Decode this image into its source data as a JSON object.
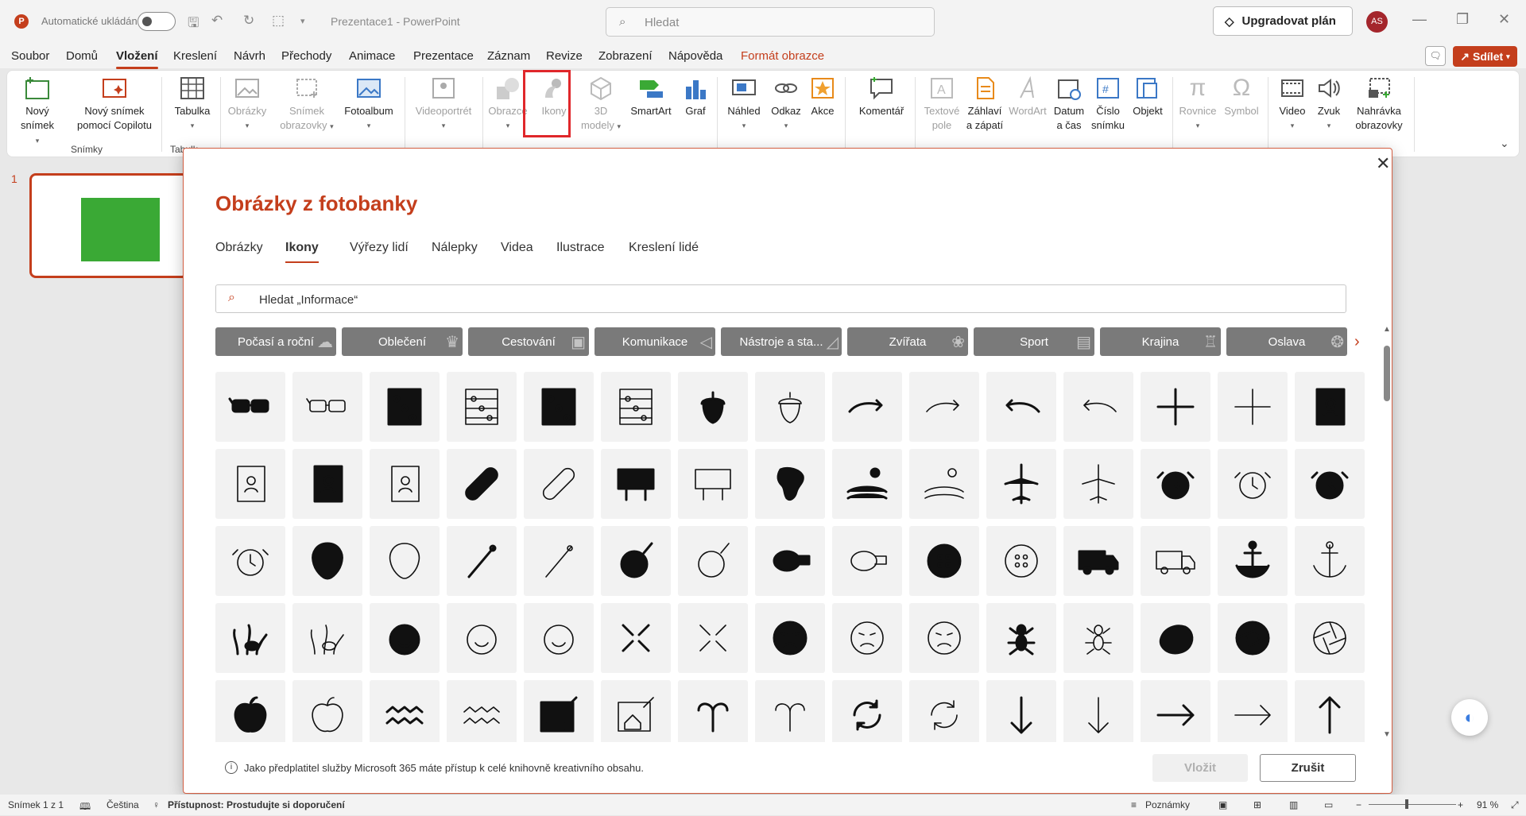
{
  "titlebar": {
    "autosave_label": "Automatické ukládání",
    "doc_title": "Prezentace1 - PowerPoint",
    "search_placeholder": "Hledat",
    "upgrade_label": "Upgradovat plán",
    "avatar_initials": "AS"
  },
  "menu": {
    "items": [
      "Soubor",
      "Domů",
      "Vložení",
      "Kreslení",
      "Návrh",
      "Přechody",
      "Animace",
      "Prezentace",
      "Záznam",
      "Revize",
      "Zobrazení",
      "Nápověda",
      "Formát obrazce"
    ],
    "active": "Vložení",
    "share_label": "Sdílet"
  },
  "ribbon": {
    "buttons": [
      {
        "label1": "Nový",
        "label2": "snímek",
        "icon": "new-slide-icon"
      },
      {
        "label1": "Nový snímek",
        "label2": "pomocí Copilotu",
        "icon": "copilot-slide-icon"
      },
      {
        "label1": "Tabulka",
        "label2": "",
        "icon": "table-icon"
      },
      {
        "label1": "Obrázky",
        "label2": "",
        "icon": "pictures-icon"
      },
      {
        "label1": "Snímek",
        "label2": "obrazovky",
        "icon": "screenshot-icon"
      },
      {
        "label1": "Fotoalbum",
        "label2": "",
        "icon": "photo-album-icon"
      },
      {
        "label1": "Videoportrét",
        "label2": "",
        "icon": "video-portrait-icon"
      },
      {
        "label1": "Obrazce",
        "label2": "",
        "icon": "shapes-icon"
      },
      {
        "label1": "Ikony",
        "label2": "",
        "icon": "icons-icon"
      },
      {
        "label1": "3D",
        "label2": "modely",
        "icon": "3d-models-icon"
      },
      {
        "label1": "SmartArt",
        "label2": "",
        "icon": "smartart-icon"
      },
      {
        "label1": "Graf",
        "label2": "",
        "icon": "chart-icon"
      },
      {
        "label1": "Náhled",
        "label2": "",
        "icon": "preview-icon"
      },
      {
        "label1": "Odkaz",
        "label2": "",
        "icon": "link-icon"
      },
      {
        "label1": "Akce",
        "label2": "",
        "icon": "action-icon"
      },
      {
        "label1": "Komentář",
        "label2": "",
        "icon": "comment-icon"
      },
      {
        "label1": "Textové",
        "label2": "pole",
        "icon": "textbox-icon"
      },
      {
        "label1": "Záhlaví",
        "label2": "a zápatí",
        "icon": "header-footer-icon"
      },
      {
        "label1": "WordArt",
        "label2": "",
        "icon": "wordart-icon"
      },
      {
        "label1": "Datum",
        "label2": "a čas",
        "icon": "date-time-icon"
      },
      {
        "label1": "Číslo",
        "label2": "snímku",
        "icon": "slide-number-icon"
      },
      {
        "label1": "Objekt",
        "label2": "",
        "icon": "object-icon"
      },
      {
        "label1": "Rovnice",
        "label2": "",
        "icon": "equation-icon"
      },
      {
        "label1": "Symbol",
        "label2": "",
        "icon": "symbol-icon"
      },
      {
        "label1": "Video",
        "label2": "",
        "icon": "video-icon"
      },
      {
        "label1": "Zvuk",
        "label2": "",
        "icon": "audio-icon"
      },
      {
        "label1": "Nahrávka",
        "label2": "obrazovky",
        "icon": "screen-recording-icon"
      }
    ],
    "groups": [
      "Snímky",
      "Tabulk"
    ]
  },
  "thumbnails": {
    "slide_number": "1",
    "fill_color": "#3aa935"
  },
  "dialog": {
    "title": "Obrázky z fotobanky",
    "tabs": [
      "Obrázky",
      "Ikony",
      "Výřezy lidí",
      "Nálepky",
      "Videa",
      "Ilustrace",
      "Kreslení lidé"
    ],
    "active_tab": "Ikony",
    "search_placeholder": "Hledat „Informace“",
    "categories": [
      "Počasí a roční",
      "Oblečení",
      "Cestování",
      "Komunikace",
      "Nástroje a sta...",
      "Zvířata",
      "Sport",
      "Krajina",
      "Oslava"
    ],
    "icons": [
      "3d-glasses-filled",
      "3d-glasses-outline",
      "abacus-filled",
      "abacus-outline",
      "abacus-bold",
      "abacus-thin",
      "acorn-filled",
      "acorn-outline",
      "arrow-curve-right-bold",
      "arrow-curve-right-thin",
      "arrow-curve-left-bold",
      "arrow-curve-left-thin",
      "plus-bold",
      "plus-thin",
      "address-book-filled",
      "address-book-outline",
      "address-book-dark",
      "address-book-light",
      "bandage-filled",
      "bandage-outline",
      "billboard-filled",
      "billboard-outline",
      "africa-filled",
      "farm-landscape-filled",
      "farm-landscape-outline",
      "airplane-filled",
      "airplane-outline",
      "alarm-clock-filled",
      "alarm-clock-outline",
      "alarm-ringing-filled",
      "alarm-ringing-outline",
      "alien-filled",
      "alien-outline",
      "needle-filled",
      "needle-outline",
      "yarn-filled",
      "yarn-outline",
      "measuring-tape-filled",
      "measuring-tape-outline",
      "button-filled",
      "button-outline",
      "ambulance-filled",
      "ambulance-outline",
      "anchor-filled",
      "anchor-outline",
      "coral-fish-filled",
      "coral-fish-outline",
      "angel-face-filled",
      "angel-face-outline",
      "angel-face-light",
      "annoyed-face-filled",
      "annoyed-face-outline",
      "angry-face-filled",
      "angry-face-outline",
      "angry-face-light",
      "ant-filled",
      "ant-outline",
      "antarctica-filled",
      "aperture-filled",
      "aperture-outline",
      "apple-filled",
      "apple-outline",
      "aquarius-filled",
      "aquarius-outline",
      "architecture-filled",
      "architecture-outline",
      "aries-filled",
      "aries-outline",
      "refresh-filled",
      "refresh-outline",
      "arrow-down-bold",
      "arrow-down-thin",
      "arrow-right-bold",
      "arrow-right-thin",
      "arrow-up-bold"
    ],
    "info_text": "Jako předplatitel služby Microsoft 365 máte přístup k celé knihovně kreativního obsahu.",
    "insert_label": "Vložit",
    "cancel_label": "Zrušit"
  },
  "status": {
    "slide_info": "Snímek 1 z 1",
    "language": "Čeština",
    "accessibility": "Přístupnost: Prostudujte si doporučení",
    "notes_label": "Poznámky",
    "zoom": "91 %"
  }
}
